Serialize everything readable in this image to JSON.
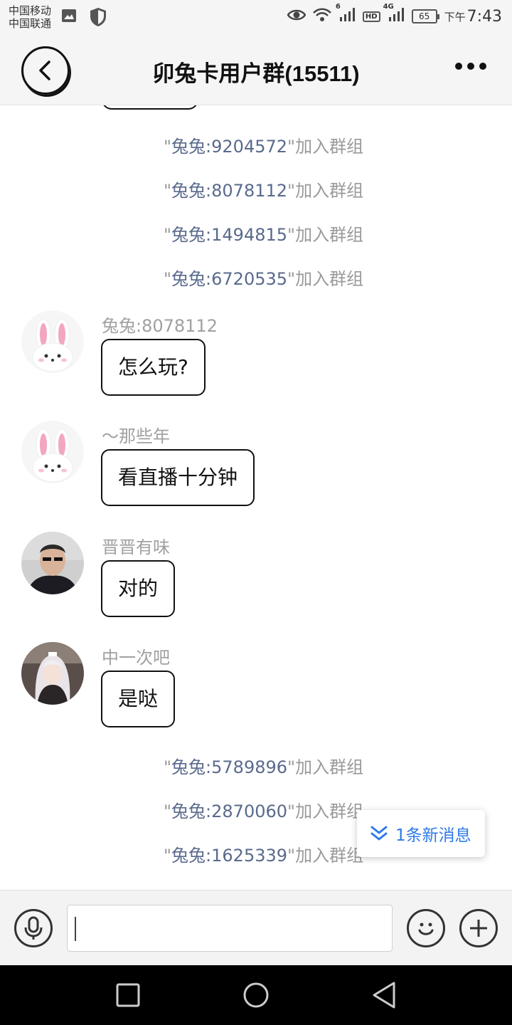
{
  "status_bar": {
    "carrier_1": "中国移动",
    "carrier_2": "中国联通",
    "network_6g": "6",
    "network_4g": "4G",
    "hd": "HD",
    "battery": "65",
    "ampm": "下午",
    "time": "7:43",
    "icons": [
      "image-icon",
      "shield-icon",
      "eye-icon",
      "wifi-icon",
      "signal-icon",
      "battery-icon"
    ]
  },
  "header": {
    "title": "卯兔卡用户群(15511)"
  },
  "join_suffix": "\"加入群组",
  "system_messages_top": [
    {
      "quote": "\"",
      "user": "兔兔:9204572",
      "suffix": "\"加入群组"
    },
    {
      "quote": "\"",
      "user": "兔兔:8078112",
      "suffix": "\"加入群组"
    },
    {
      "quote": "\"",
      "user": "兔兔:1494815",
      "suffix": "\"加入群组"
    },
    {
      "quote": "\"",
      "user": "兔兔:6720535",
      "suffix": "\"加入群组"
    }
  ],
  "messages": [
    {
      "sender": "兔兔:8078112",
      "text": "怎么玩?",
      "avatar": "rabbit-avatar"
    },
    {
      "sender": "～那些年",
      "text": "看直播十分钟",
      "avatar": "rabbit-avatar"
    },
    {
      "sender": "晋晋有味",
      "text": "对的",
      "avatar": "man-photo-avatar"
    },
    {
      "sender": "中一次吧",
      "text": "是哒",
      "avatar": "anime-girl-avatar"
    }
  ],
  "system_messages_bottom": [
    {
      "quote": "\"",
      "user": "兔兔:5789896",
      "suffix": "\"加入群组"
    },
    {
      "quote": "\"",
      "user": "兔兔:2870060",
      "suffix": "\"加入群组"
    },
    {
      "quote": "\"",
      "user": "兔兔:1625339",
      "suffix": "\"加入群组"
    }
  ],
  "new_message_indicator": {
    "label": "1条新消息",
    "icon": "double-chevron-down-icon"
  },
  "input_bar": {
    "value": "",
    "icons": [
      "microphone-icon",
      "emoji-icon",
      "plus-icon"
    ]
  },
  "nav_bar": {
    "icons": [
      "recents-square-icon",
      "home-circle-icon",
      "back-triangle-icon"
    ]
  }
}
